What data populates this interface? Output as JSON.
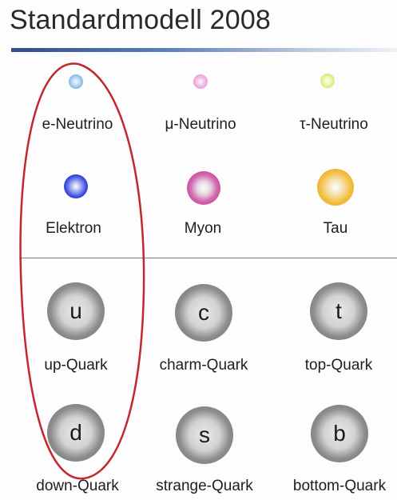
{
  "title": "Standardmodell 2008",
  "colors": {
    "title_bar": "#2f4f86",
    "highlight_ellipse": "#c2272d"
  },
  "leptons": {
    "neutrinos": [
      {
        "label": "e-Neutrino",
        "color": "#7fb9e8"
      },
      {
        "label": "μ-Neutrino",
        "color": "#e9a0d6"
      },
      {
        "label": "τ-Neutrino",
        "color": "#d9e87a"
      }
    ],
    "charged": [
      {
        "label": "Elektron",
        "color": "#2f3fd8"
      },
      {
        "label": "Myon",
        "color": "#c2308f"
      },
      {
        "label": "Tau",
        "color": "#f0b020"
      }
    ]
  },
  "quarks": {
    "upper": [
      {
        "symbol": "u",
        "label": "up-Quark"
      },
      {
        "symbol": "c",
        "label": "charm-Quark"
      },
      {
        "symbol": "t",
        "label": "top-Quark"
      }
    ],
    "lower": [
      {
        "symbol": "d",
        "label": "down-Quark"
      },
      {
        "symbol": "s",
        "label": "strange-Quark"
      },
      {
        "symbol": "b",
        "label": "bottom-Quark"
      }
    ]
  }
}
